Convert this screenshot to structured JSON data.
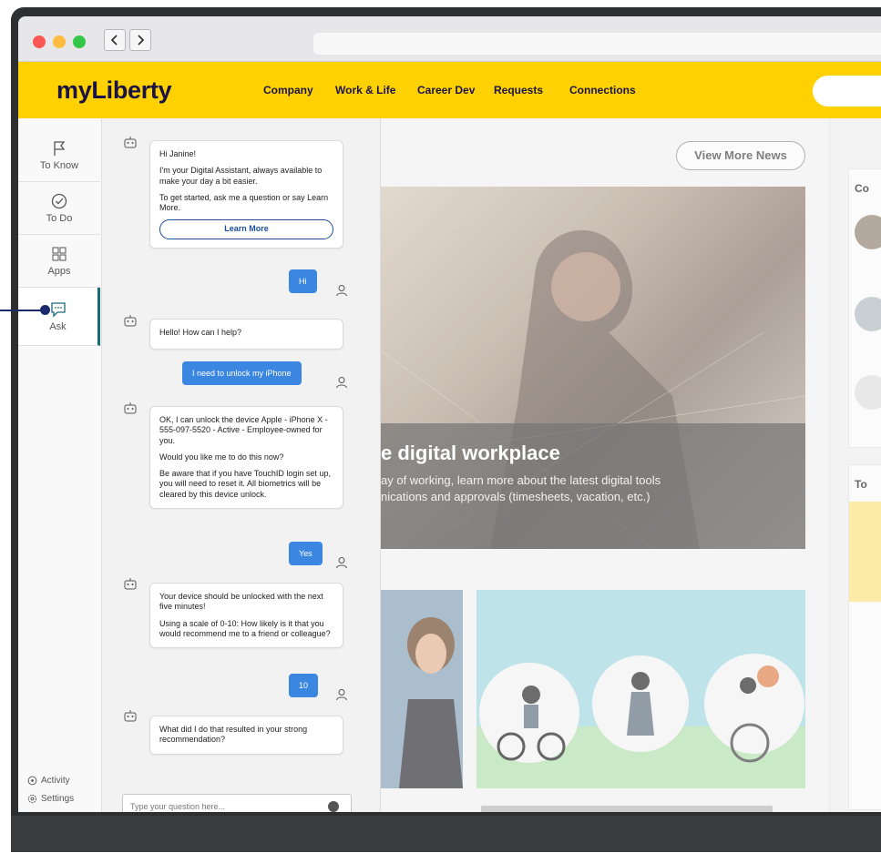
{
  "header": {
    "logo": "myLiberty",
    "nav": [
      "Company",
      "Work & Life",
      "Career Dev",
      "Requests",
      "Connections"
    ]
  },
  "rail": {
    "items": [
      {
        "label": "To Know",
        "icon": "flag-icon"
      },
      {
        "label": "To Do",
        "icon": "check-circle-icon"
      },
      {
        "label": "Apps",
        "icon": "grid-icon"
      },
      {
        "label": "Ask",
        "icon": "chat-icon"
      }
    ],
    "activity": "Activity",
    "settings": "Settings"
  },
  "chat": {
    "messages": [
      {
        "from": "bot",
        "lines": [
          "Hi Janine!",
          "I'm your Digital Assistant, always available to make your day a bit easier.",
          "To get started, ask me a question or say Learn More."
        ],
        "button": "Learn More"
      },
      {
        "from": "user",
        "text": "Hi"
      },
      {
        "from": "bot",
        "lines": [
          "Hello! How can I help?"
        ]
      },
      {
        "from": "user",
        "text": "I need to unlock my iPhone"
      },
      {
        "from": "bot",
        "lines": [
          "OK, I can unlock the device Apple - iPhone X - 555-097-5520 - Active - Employee-owned for you.",
          "Would you like me to do this now?",
          "Be aware that if you have TouchID login set up, you will need to reset it. All biometrics will be cleared by this device unlock."
        ]
      },
      {
        "from": "user",
        "text": "Yes"
      },
      {
        "from": "bot",
        "lines": [
          "Your device should be unlocked with the next five minutes!",
          "Using a scale of 0-10: How likely is it that you would recommend me to a friend or colleague?"
        ]
      },
      {
        "from": "user",
        "text": "10"
      },
      {
        "from": "bot",
        "lines": [
          "What did I do that resulted in your strong recommendation?"
        ]
      }
    ],
    "input_placeholder": "Type your question here..."
  },
  "main": {
    "view_more": "View More News",
    "hero_title": "e digital workplace",
    "hero_sub_1": "ay of working, learn more about the latest digital tools",
    "hero_sub_2": "nications and approvals (timesheets, vacation, etc.)",
    "right_label_1": "Co",
    "right_label_2": "To"
  },
  "colors": {
    "brand_yellow": "#ffd100",
    "brand_navy": "#1a1446",
    "user_bubble": "#3b86e0",
    "rail_active": "#1a6b7a"
  }
}
